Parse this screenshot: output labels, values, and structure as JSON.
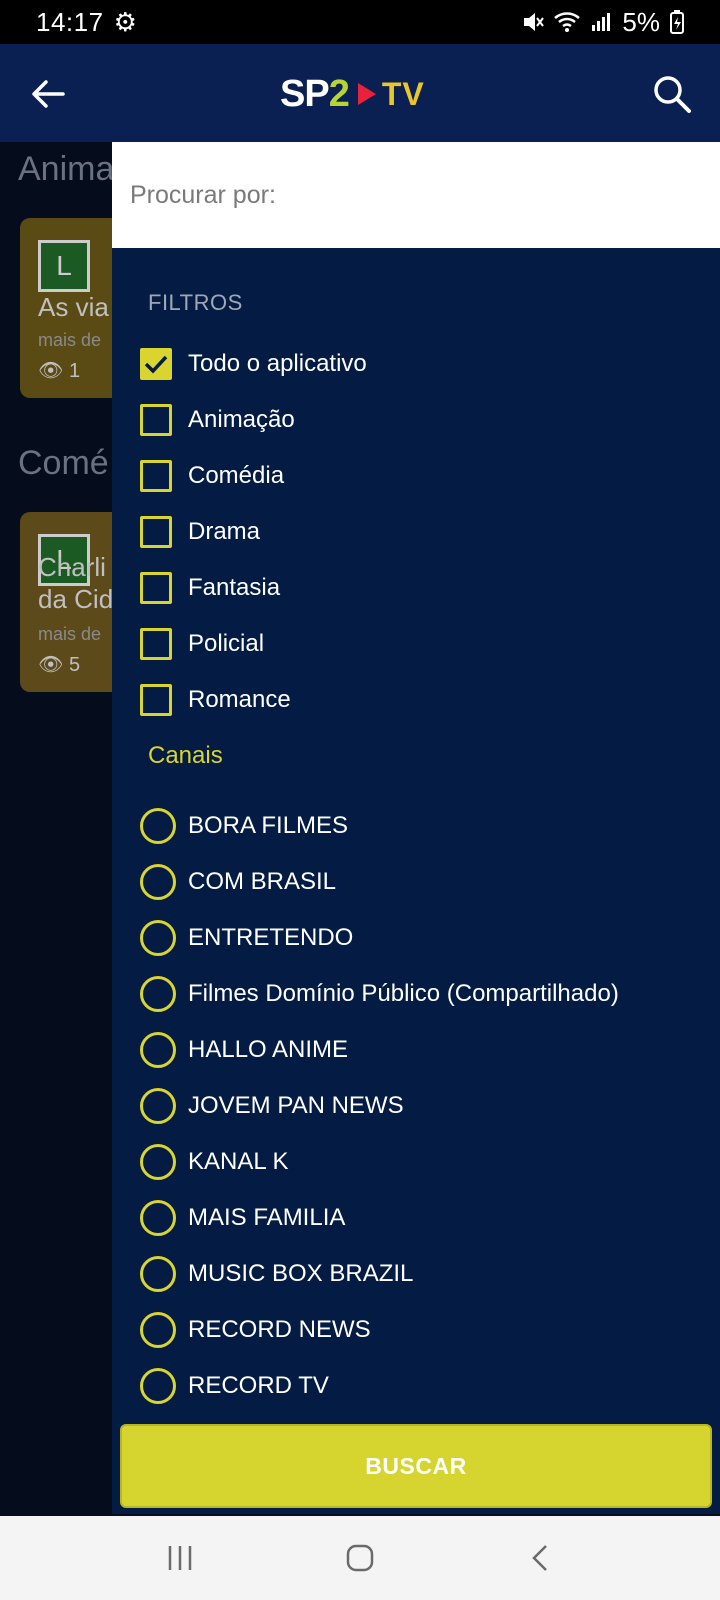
{
  "status_bar": {
    "time": "14:17",
    "battery": "5%",
    "icons": [
      "gear-icon",
      "mute-icon",
      "wifi-icon",
      "signal-icon",
      "battery-icon"
    ]
  },
  "app_bar": {
    "logo_sp": "SP",
    "logo_two": "2",
    "logo_tv": "TV",
    "icons": [
      "back-arrow-icon",
      "play-icon",
      "search-icon"
    ]
  },
  "background": {
    "section_1": "Anima",
    "section_2": "Comé",
    "card_1": {
      "badge": "L",
      "title": "As via",
      "sub": "mais de",
      "views": "1"
    },
    "card_2": {
      "badge": "L",
      "title": "Charli",
      "title2": "da Cid",
      "sub": "mais de",
      "views": "5"
    }
  },
  "drawer": {
    "search_placeholder": "Procurar por:",
    "filters_heading": "FILTROS",
    "filters": [
      {
        "label": "Todo o aplicativo",
        "checked": true
      },
      {
        "label": "Animação",
        "checked": false
      },
      {
        "label": "Comédia",
        "checked": false
      },
      {
        "label": "Drama",
        "checked": false
      },
      {
        "label": "Fantasia",
        "checked": false
      },
      {
        "label": "Policial",
        "checked": false
      },
      {
        "label": "Romance",
        "checked": false
      }
    ],
    "channels_heading": "Canais",
    "channels": [
      "BORA FILMES",
      "COM BRASIL",
      "ENTRETENDO",
      "Filmes Domínio Público (Compartilhado)",
      "HALLO ANIME",
      "JOVEM PAN NEWS",
      "KANAL K",
      "MAIS FAMILIA",
      "MUSIC BOX BRAZIL",
      "RECORD NEWS",
      "RECORD TV"
    ],
    "button_label": "BUSCAR"
  },
  "colors": {
    "app_bar": "#0a1f52",
    "drawer": "#041c44",
    "accent": "#d9d52e",
    "button": "#d6d42e"
  },
  "nav_bar": {
    "icons": [
      "recents-icon",
      "home-icon",
      "back-icon"
    ]
  }
}
